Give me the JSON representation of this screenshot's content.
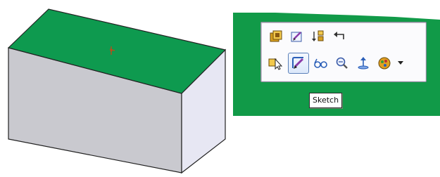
{
  "colors": {
    "top_face": "#0e9a4f",
    "front_face": "#c9c9cf",
    "side_face": "#e7e7f3",
    "inset_green": "#119a48",
    "edge": "#222222"
  },
  "model": {
    "origin_marker_icon": "origin-triad-icon"
  },
  "toolbar": {
    "row1": [
      {
        "name": "smart-dimension-icon"
      },
      {
        "name": "edit-sketch-icon"
      },
      {
        "name": "insert-components-icon"
      },
      {
        "name": "undo-return-icon"
      }
    ],
    "row2": [
      {
        "name": "select-icon"
      },
      {
        "name": "sketch-icon",
        "active": true
      },
      {
        "name": "view-glasses-icon"
      },
      {
        "name": "zoom-icon"
      },
      {
        "name": "normal-to-icon"
      },
      {
        "name": "appearance-icon"
      }
    ],
    "dropdown_icon": "chevron-down-icon"
  },
  "tooltip": {
    "text": "Sketch"
  }
}
